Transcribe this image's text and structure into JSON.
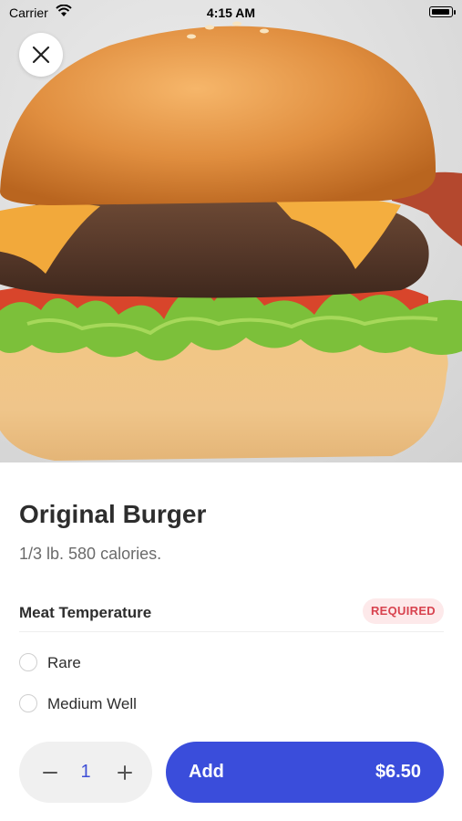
{
  "status_bar": {
    "carrier": "Carrier",
    "time": "4:15 AM",
    "battery_level": 1.0
  },
  "hero": {
    "image_alt": "burger-photo",
    "close_icon": "close-icon"
  },
  "item": {
    "title": "Original Burger",
    "description": "1/3 lb. 580 calories."
  },
  "modifier_group": {
    "label": "Meat Temperature",
    "badge": "REQUIRED",
    "options": [
      {
        "label": "Rare",
        "selected": false
      },
      {
        "label": "Medium Well",
        "selected": false
      }
    ]
  },
  "cart": {
    "quantity": "1",
    "minus_icon": "minus-icon",
    "plus_icon": "plus-icon",
    "add_label": "Add",
    "price": "$6.50"
  },
  "colors": {
    "accent": "#3a4ddb",
    "required_bg": "#fde9ea",
    "required_text": "#d8434f",
    "stepper_bg": "#f0f0f0"
  }
}
